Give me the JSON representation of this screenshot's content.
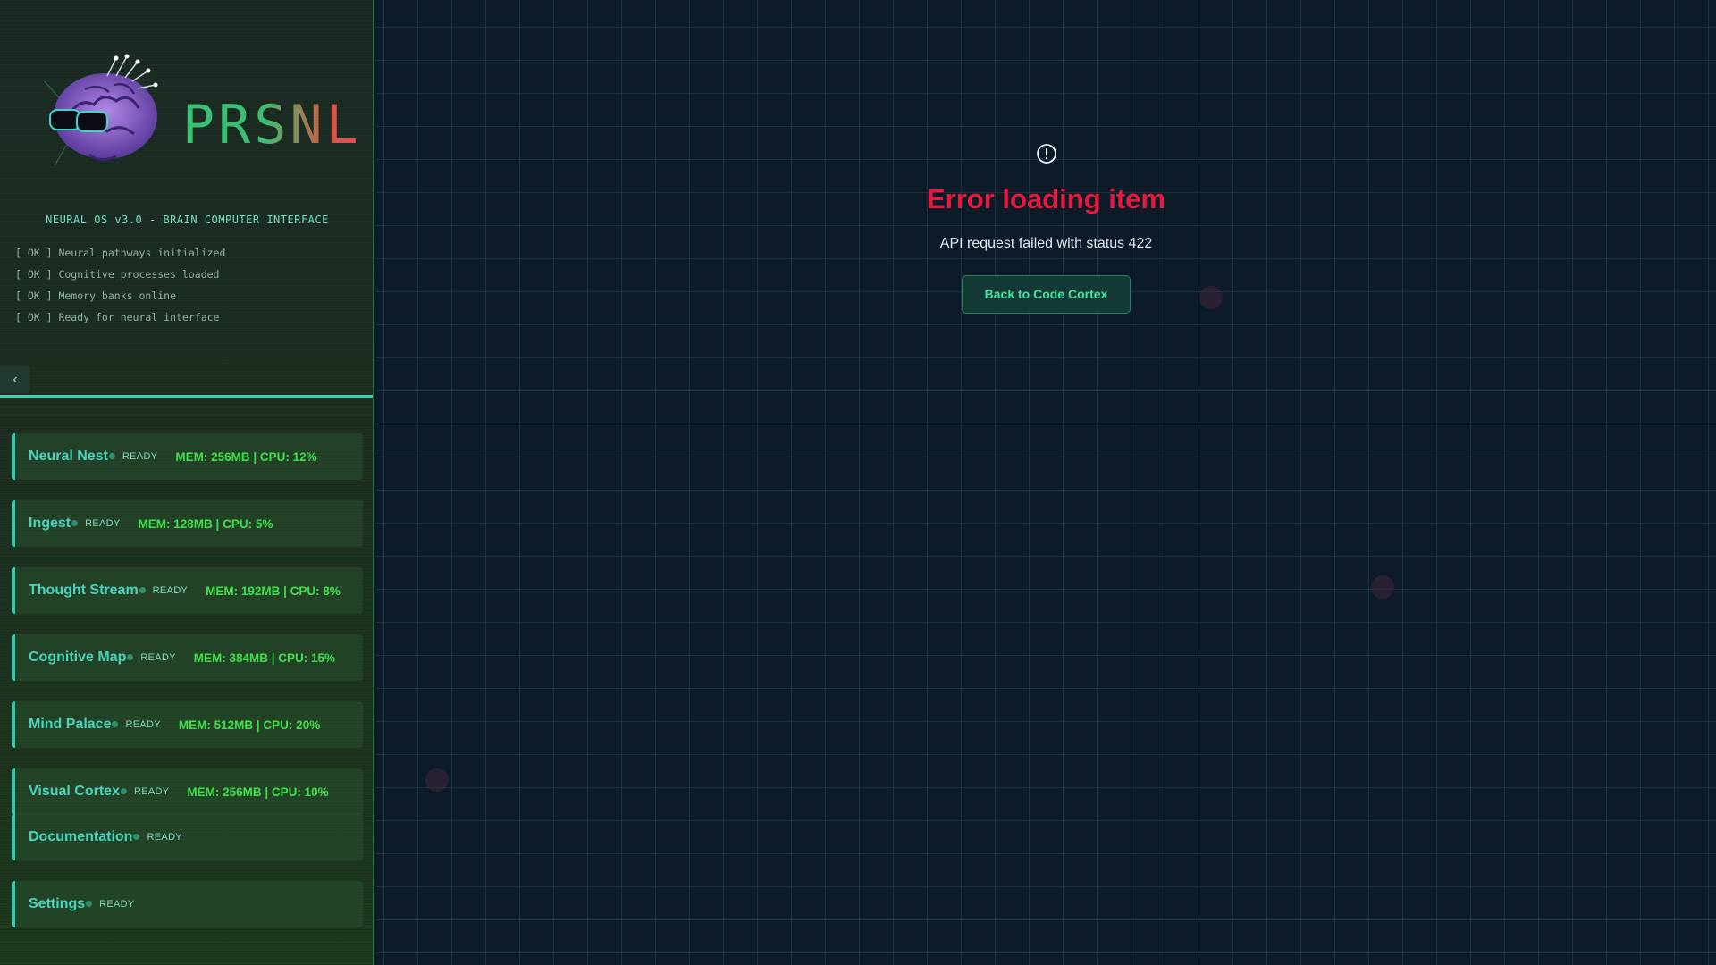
{
  "app": {
    "logo_text": "PRSNL",
    "os_title": "NEURAL OS v3.0 - BRAIN COMPUTER INTERFACE",
    "boot_log": [
      "[ OK ] Neural pathways initialized",
      "[ OK ] Cognitive processes loaded",
      "[ OK ] Memory banks online",
      "[ OK ] Ready for neural interface"
    ],
    "collapse_icon": "‹"
  },
  "nav": [
    {
      "label": "Neural Nest",
      "status": "READY",
      "metrics": "MEM: 256MB | CPU: 12%"
    },
    {
      "label": "Ingest",
      "status": "READY",
      "metrics": "MEM: 128MB | CPU: 5%"
    },
    {
      "label": "Thought Stream",
      "status": "READY",
      "metrics": "MEM: 192MB | CPU: 8%"
    },
    {
      "label": "Cognitive Map",
      "status": "READY",
      "metrics": "MEM: 384MB | CPU: 15%"
    },
    {
      "label": "Mind Palace",
      "status": "READY",
      "metrics": "MEM: 512MB | CPU: 20%"
    },
    {
      "label": "Visual Cortex",
      "status": "READY",
      "metrics": "MEM: 256MB | CPU: 10%"
    },
    {
      "label": "Documentation",
      "status": "READY",
      "metrics": ""
    },
    {
      "label": "Settings",
      "status": "READY",
      "metrics": ""
    }
  ],
  "error": {
    "icon": "alert-circle-icon",
    "title": "Error loading item",
    "message": "API request failed with status 422",
    "button_label": "Back to Code Cortex"
  },
  "colors": {
    "accent": "#48d4bc",
    "error": "#e8193f",
    "metrics": "#3ee04a"
  }
}
